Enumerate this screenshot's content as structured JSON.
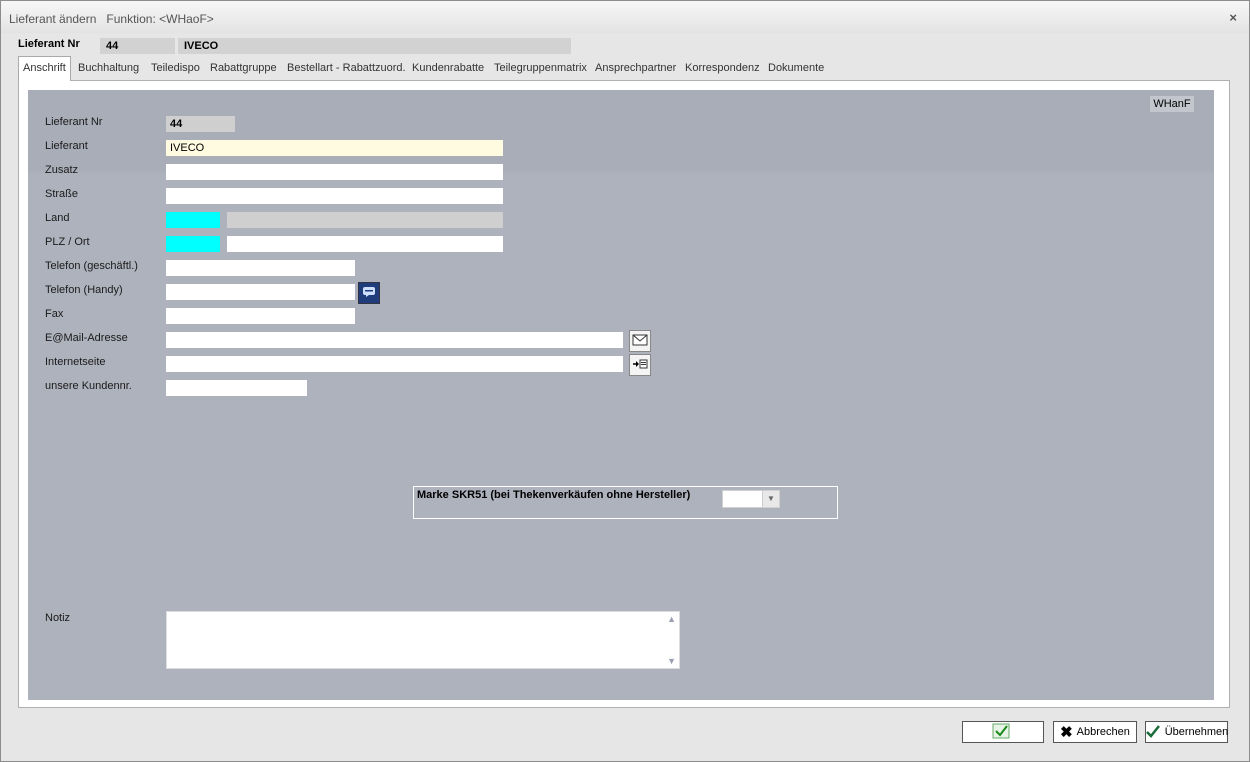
{
  "window": {
    "title": "Lieferant ändern",
    "function": "Funktion: <WHaoF>",
    "close": "×"
  },
  "header": {
    "label": "Lieferant Nr",
    "nr": "44",
    "name": "IVECO"
  },
  "tabs": [
    {
      "label": "Anschrift",
      "active": true
    },
    {
      "label": "Buchhaltung"
    },
    {
      "label": "Teiledispo"
    },
    {
      "label": "Rabattgruppe"
    },
    {
      "label": "Bestellart - Rabattzuord."
    },
    {
      "label": "Kundenrabatte"
    },
    {
      "label": "Teilegruppenmatrix"
    },
    {
      "label": "Ansprechpartner"
    },
    {
      "label": "Korrespondenz"
    },
    {
      "label": "Dokumente"
    }
  ],
  "form": {
    "badge": "WHanF",
    "fields": {
      "lieferant_nr": {
        "label": "Lieferant Nr",
        "value": "44"
      },
      "lieferant": {
        "label": "Lieferant",
        "value": "IVECO"
      },
      "zusatz": {
        "label": "Zusatz",
        "value": ""
      },
      "strasse": {
        "label": "Straße",
        "value": ""
      },
      "land": {
        "label": "Land",
        "code": "",
        "name": ""
      },
      "plz_ort": {
        "label": "PLZ / Ort",
        "plz": "",
        "ort": ""
      },
      "telefon_geschaeftl": {
        "label": "Telefon (geschäftl.)",
        "value": ""
      },
      "telefon_handy": {
        "label": "Telefon (Handy)",
        "value": ""
      },
      "fax": {
        "label": "Fax",
        "value": ""
      },
      "email": {
        "label": "E@Mail-Adresse",
        "value": ""
      },
      "internetseite": {
        "label": "Internetseite",
        "value": ""
      },
      "kundennr": {
        "label": "unsere Kundennr.",
        "value": ""
      }
    },
    "marke": {
      "label": "Marke SKR51 (bei Thekenverkäufen ohne Hersteller)",
      "value": ""
    },
    "notiz": {
      "label": "Notiz",
      "value": ""
    }
  },
  "buttons": {
    "ok": "",
    "abbrechen": "Abbrechen",
    "uebernehmen": "Übernehmen"
  },
  "colors": {
    "panel": "#a9adb8",
    "required": "#00ffff",
    "highlight": "#fffbe0"
  }
}
